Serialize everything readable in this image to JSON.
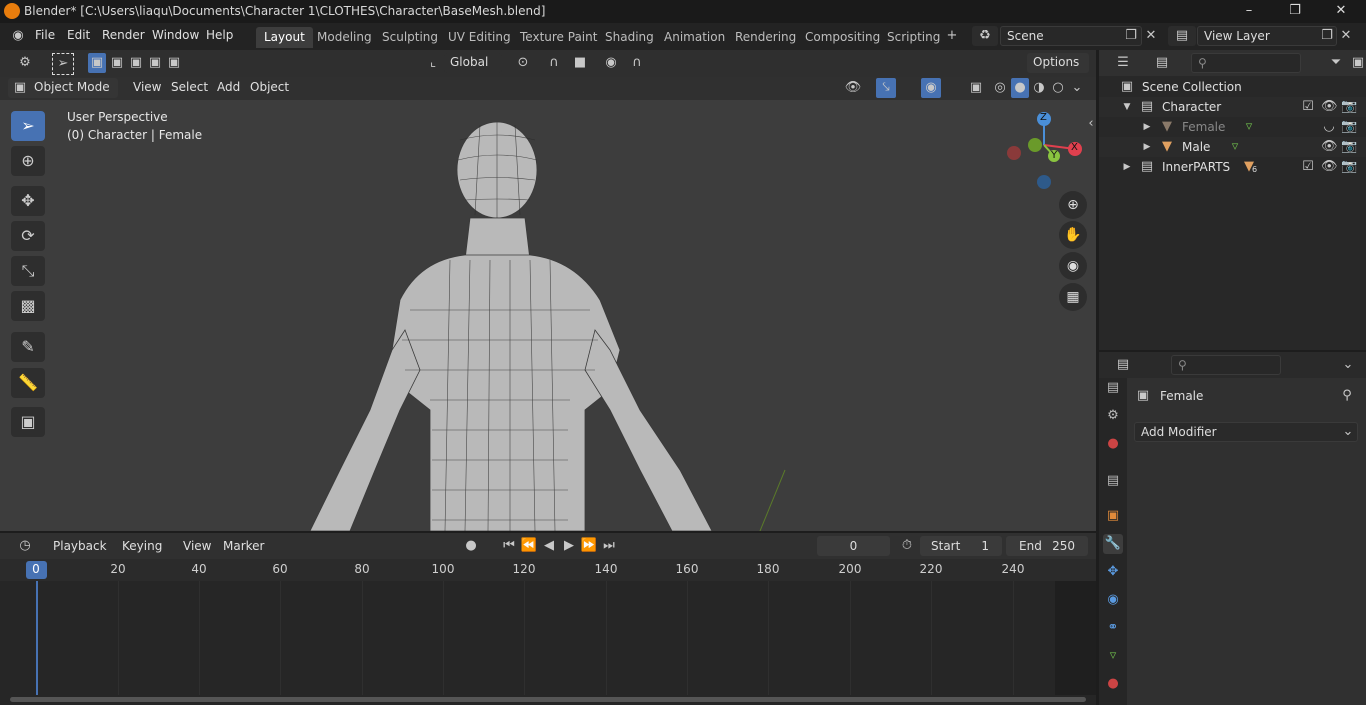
{
  "window": {
    "title": "Blender* [C:\\Users\\liaqu\\Documents\\Character 1\\CLOTHES\\Character\\BaseMesh.blend]"
  },
  "menu": [
    "File",
    "Edit",
    "Render",
    "Window",
    "Help"
  ],
  "workspaces": [
    "Layout",
    "Modeling",
    "Sculpting",
    "UV Editing",
    "Texture Paint",
    "Shading",
    "Animation",
    "Rendering",
    "Compositing",
    "Scripting"
  ],
  "active_workspace": "Layout",
  "scene": "Scene",
  "view_layer": "View Layer",
  "toolbar": {
    "orientation": "Global",
    "options": "Options"
  },
  "viewport_header": {
    "mode": "Object Mode",
    "menus": [
      "View",
      "Select",
      "Add",
      "Object"
    ]
  },
  "viewport": {
    "perspective": "User Perspective",
    "object_info": "(0) Character | Female"
  },
  "gizmo": {
    "z": "Z",
    "y": "Y",
    "x": "X"
  },
  "outliner": {
    "root": "Scene Collection",
    "items": [
      {
        "name": "Character",
        "level": 1
      },
      {
        "name": "Female",
        "level": 2
      },
      {
        "name": "Male",
        "level": 2
      },
      {
        "name": "InnerPARTS",
        "level": 1,
        "badge": "6"
      }
    ]
  },
  "properties": {
    "object_name": "Female",
    "add_modifier": "Add Modifier"
  },
  "timeline": {
    "menus": [
      "Playback",
      "Keying",
      "View",
      "Marker"
    ],
    "current_frame": "0",
    "start_label": "Start",
    "start": "1",
    "end_label": "End",
    "end": "250",
    "ticks": [
      "0",
      "20",
      "40",
      "60",
      "80",
      "100",
      "120",
      "140",
      "160",
      "180",
      "200",
      "220",
      "240"
    ]
  },
  "colors": {
    "accent": "#4772b3",
    "x_axis": "#e0404e",
    "y_axis": "#8ac440",
    "z_axis": "#4a8fd8",
    "mesh_icon": "#e0a060"
  }
}
